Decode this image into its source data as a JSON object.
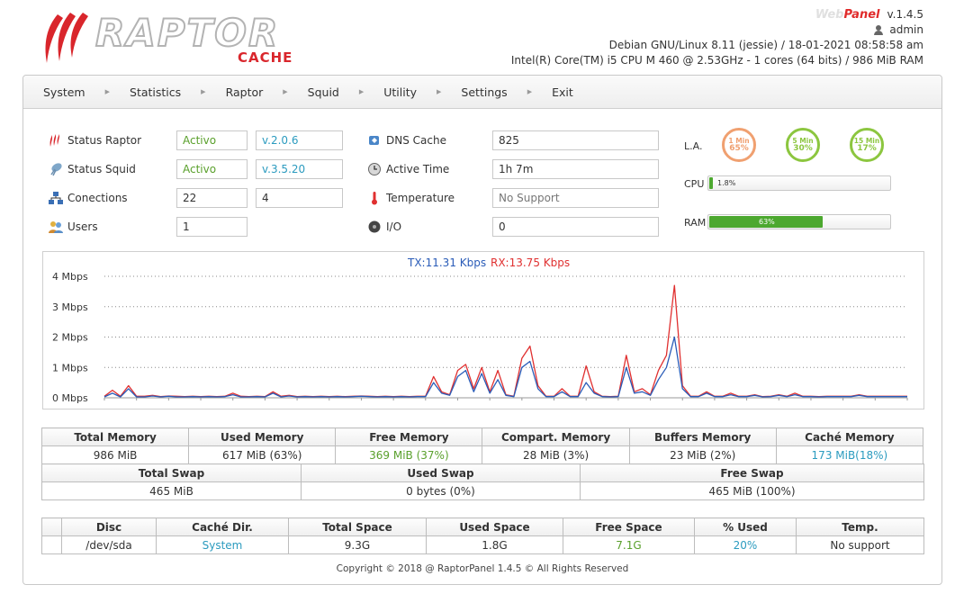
{
  "header": {
    "logo": {
      "title": "RAPTOR",
      "subtitle": "CACHE"
    },
    "app_web": "Web",
    "app_panel": "Panel",
    "app_version": "v.1.4.5",
    "user": "admin",
    "system_line": "Debian GNU/Linux 8.11 (jessie) / 18-01-2021 08:58:58 am",
    "cpu_line": "Intel(R) Core(TM) i5 CPU M 460 @ 2.53GHz -  1 cores  (64 bits)  /  986 MiB RAM"
  },
  "menu": [
    "System",
    "Statistics",
    "Raptor",
    "Squid",
    "Utility",
    "Settings",
    "Exit"
  ],
  "status": {
    "raptor": {
      "label": "Status Raptor",
      "state": "Activo",
      "version": "v.2.0.6"
    },
    "squid": {
      "label": "Status Squid",
      "state": "Activo",
      "version": "v.3.5.20"
    },
    "connections": {
      "label": "Conections",
      "a": "22",
      "b": "4"
    },
    "users": {
      "label": "Users",
      "value": "1"
    },
    "dns": {
      "label": "DNS Cache",
      "value": "825"
    },
    "active_time": {
      "label": "Active Time",
      "value": "1h 7m"
    },
    "temperature": {
      "label": "Temperature",
      "value": "No Support"
    },
    "io": {
      "label": "I/O",
      "value": "0"
    }
  },
  "load": {
    "label": "L.A.",
    "items": [
      {
        "label": "1 Min",
        "value": "65%",
        "color": "#f0a070"
      },
      {
        "label": "5 Min",
        "value": "30%",
        "color": "#8cc63f"
      },
      {
        "label": "15 Min",
        "value": "17%",
        "color": "#8cc63f"
      }
    ]
  },
  "cpu": {
    "label": "CPU",
    "text": "1.8%",
    "percent": 1.8
  },
  "ram": {
    "label": "RAM",
    "text": "63%",
    "percent": 63
  },
  "chart_data": {
    "type": "line",
    "title": "",
    "legend": [
      {
        "name": "TX:11.31 Kbps",
        "color": "#2a5cb8"
      },
      {
        "name": "RX:13.75 Kbps",
        "color": "#e03030"
      }
    ],
    "y_ticks": [
      "0 Mbps",
      "1 Mbps",
      "2 Mbps",
      "3 Mbps",
      "4 Mbps"
    ],
    "ylim": [
      0,
      4
    ],
    "grid": true,
    "x": [
      0,
      1,
      2,
      3,
      4,
      5,
      6,
      7,
      8,
      9,
      10,
      11,
      12,
      13,
      14,
      15,
      16,
      17,
      18,
      19,
      20,
      21,
      22,
      23,
      24,
      25,
      26,
      27,
      28,
      29,
      30,
      31,
      32,
      33,
      34,
      35,
      36,
      37,
      38,
      39,
      40,
      41,
      42,
      43,
      44,
      45,
      46,
      47,
      48,
      49,
      50,
      51,
      52,
      53,
      54,
      55,
      56,
      57,
      58,
      59,
      60,
      61,
      62,
      63,
      64,
      65,
      66,
      67,
      68,
      69,
      70,
      71,
      72,
      73,
      74,
      75,
      76,
      77,
      78,
      79,
      80,
      81,
      82,
      83,
      84,
      85,
      86,
      87,
      88,
      89,
      90,
      91,
      92,
      93,
      94,
      95,
      96,
      97,
      98,
      99,
      100
    ],
    "series": [
      {
        "name": "RX",
        "color": "#e03030",
        "values": [
          0.05,
          0.25,
          0.05,
          0.4,
          0.05,
          0.05,
          0.08,
          0.04,
          0.06,
          0.05,
          0.04,
          0.05,
          0.04,
          0.05,
          0.04,
          0.05,
          0.15,
          0.05,
          0.04,
          0.05,
          0.04,
          0.2,
          0.05,
          0.08,
          0.04,
          0.05,
          0.04,
          0.05,
          0.04,
          0.05,
          0.04,
          0.05,
          0.06,
          0.05,
          0.04,
          0.05,
          0.04,
          0.05,
          0.04,
          0.05,
          0.05,
          0.7,
          0.2,
          0.1,
          0.9,
          1.1,
          0.3,
          1.0,
          0.2,
          0.9,
          0.1,
          0.05,
          1.3,
          1.7,
          0.4,
          0.05,
          0.05,
          0.3,
          0.05,
          0.05,
          1.05,
          0.2,
          0.05,
          0.04,
          0.05,
          1.4,
          0.2,
          0.3,
          0.1,
          0.9,
          1.4,
          3.7,
          0.4,
          0.05,
          0.05,
          0.2,
          0.05,
          0.05,
          0.15,
          0.05,
          0.05,
          0.1,
          0.04,
          0.05,
          0.1,
          0.05,
          0.15,
          0.05,
          0.05,
          0.04,
          0.05,
          0.05,
          0.05,
          0.05,
          0.1,
          0.05,
          0.05,
          0.05,
          0.05,
          0.05,
          0.05
        ]
      },
      {
        "name": "TX",
        "color": "#2a5cb8",
        "values": [
          0.03,
          0.15,
          0.03,
          0.3,
          0.03,
          0.03,
          0.06,
          0.03,
          0.05,
          0.03,
          0.03,
          0.04,
          0.03,
          0.04,
          0.03,
          0.04,
          0.1,
          0.03,
          0.03,
          0.04,
          0.03,
          0.15,
          0.03,
          0.06,
          0.03,
          0.04,
          0.03,
          0.04,
          0.03,
          0.04,
          0.03,
          0.04,
          0.05,
          0.04,
          0.03,
          0.04,
          0.03,
          0.04,
          0.03,
          0.04,
          0.04,
          0.5,
          0.15,
          0.08,
          0.7,
          0.9,
          0.2,
          0.8,
          0.15,
          0.6,
          0.08,
          0.04,
          1.0,
          1.2,
          0.3,
          0.04,
          0.04,
          0.2,
          0.04,
          0.04,
          0.5,
          0.15,
          0.04,
          0.03,
          0.04,
          1.0,
          0.15,
          0.2,
          0.08,
          0.6,
          1.0,
          2.0,
          0.3,
          0.04,
          0.04,
          0.15,
          0.04,
          0.04,
          0.1,
          0.04,
          0.04,
          0.08,
          0.03,
          0.04,
          0.08,
          0.04,
          0.1,
          0.04,
          0.04,
          0.03,
          0.04,
          0.04,
          0.04,
          0.04,
          0.08,
          0.04,
          0.04,
          0.04,
          0.04,
          0.04,
          0.04
        ]
      }
    ]
  },
  "memory": {
    "headers": [
      "Total Memory",
      "Used Memory",
      "Free Memory",
      "Compart. Memory",
      "Buffers Memory",
      "Caché Memory"
    ],
    "values": [
      "986 MiB",
      "617 MiB (63%)",
      "369 MiB (37%)",
      "28 MiB (3%)",
      "23 MiB (2%)",
      "173 MiB(18%)"
    ]
  },
  "swap": {
    "headers": [
      "Total Swap",
      "Used Swap",
      "Free Swap"
    ],
    "values": [
      "465 MiB",
      "0 bytes (0%)",
      "465 MiB (100%)"
    ]
  },
  "disk": {
    "headers": [
      "Disc",
      "Caché Dir.",
      "Total Space",
      "Used Space",
      "Free Space",
      "% Used",
      "Temp."
    ],
    "row": [
      "/dev/sda",
      "System",
      "9.3G",
      "1.8G",
      "7.1G",
      "20%",
      "No support"
    ]
  },
  "footer": "Copyright © 2018 @ RaptorPanel 1.4.5 © All Rights Reserved"
}
